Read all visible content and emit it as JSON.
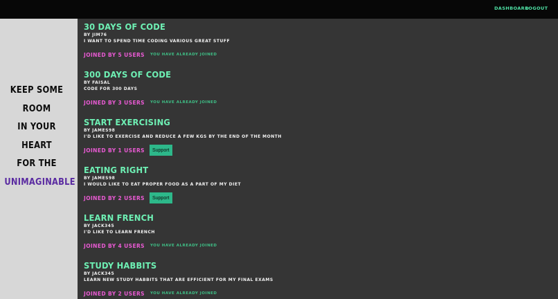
{
  "nav": {
    "dashboard": "DASHBOARD",
    "logout": "LOGOUT"
  },
  "sidebar": {
    "quote": [
      "KEEP SOME",
      "ROOM",
      "IN YOUR",
      "HEART",
      "FOR THE",
      "UNIMAGINABLE"
    ]
  },
  "challenges": [
    {
      "title": "30 DAYS OF CODE",
      "author": "BY JIM76",
      "description": "I WANT TO SPEND TIME CODING VARIOUS GREAT STUFF",
      "joined": "JOINED BY 5 USERS",
      "status": "YOU HAVE ALREADY JOINED",
      "action": ""
    },
    {
      "title": "300 DAYS OF CODE",
      "author": "BY FAISAL",
      "description": "CODE FOR 300 DAYS",
      "joined": "JOINED BY 3 USERS",
      "status": "YOU HAVE ALREADY JOINED",
      "action": ""
    },
    {
      "title": "START EXERCISING",
      "author": "BY JAMES98",
      "description": "I'D LIKE TO EXERCISE AND REDUCE A FEW KGS BY THE END OF THE MONTH",
      "joined": "JOINED BY 1 USERS",
      "status": "",
      "action": "Support"
    },
    {
      "title": "EATING RIGHT",
      "author": "BY JAMES98",
      "description": "I WOULD LIKE TO EAT PROPER FOOD AS A PART OF MY DIET",
      "joined": "JOINED BY 2 USERS",
      "status": "",
      "action": "Support"
    },
    {
      "title": "LEARN FRENCH",
      "author": "BY JACK345",
      "description": "I'D LIKE TO LEARN FRENCH",
      "joined": "JOINED BY 4 USERS",
      "status": "YOU HAVE ALREADY JOINED",
      "action": ""
    },
    {
      "title": "STUDY HABBITS",
      "author": "BY JACK345",
      "description": "LEARN NEW STUDY HABBITS THAT ARE EFFICIENT FOR MY FINAL EXAMS",
      "joined": "JOINED BY 2 USERS",
      "status": "YOU HAVE ALREADY JOINED",
      "action": ""
    }
  ],
  "colors": {
    "topbar": "#070707",
    "sidebar": "#d7d7d7",
    "main": "#353535",
    "title": "#6ef0b4",
    "joined": "#e95ad3",
    "status": "#3fbf86",
    "button": "#2db88a",
    "quote_accent": "#5a2ba1"
  }
}
